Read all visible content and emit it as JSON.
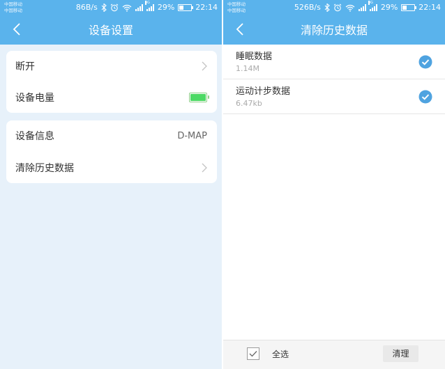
{
  "colors": {
    "accent": "#5ab3ec",
    "screen_left_bg": "#e7f1fa",
    "check_blue": "#4fa3e0",
    "battery_green": "#4cd964"
  },
  "left_screen": {
    "status": {
      "carrier1": "中国移动",
      "carrier2": "中国移动",
      "speed": "86B/s",
      "network": "4G",
      "battery": "29%",
      "battery_level": 0.29,
      "time": "22:14"
    },
    "nav": {
      "title": "设备设置",
      "back_icon": "chevron-left-icon"
    },
    "rows": {
      "disconnect": {
        "label": "断开",
        "icon": "chevron-right-icon"
      },
      "battery": {
        "label": "设备电量",
        "icon": "battery-full-icon",
        "level": 1.0
      },
      "info": {
        "label": "设备信息",
        "value": "D-MAP"
      },
      "clear_history": {
        "label": "清除历史数据",
        "icon": "chevron-right-icon"
      }
    }
  },
  "right_screen": {
    "status": {
      "carrier1": "中国移动",
      "carrier2": "中国移动",
      "speed": "526B/s",
      "network": "4G",
      "battery": "29%",
      "battery_level": 0.29,
      "time": "22:14"
    },
    "nav": {
      "title": "清除历史数据",
      "back_icon": "chevron-left-icon"
    },
    "items": [
      {
        "name": "睡眠数据",
        "size": "1.14M",
        "checked": true
      },
      {
        "name": "运动计步数据",
        "size": "6.47kb",
        "checked": true
      }
    ],
    "bottom": {
      "select_all": "全选",
      "select_all_checked": true,
      "clear": "清理"
    }
  }
}
